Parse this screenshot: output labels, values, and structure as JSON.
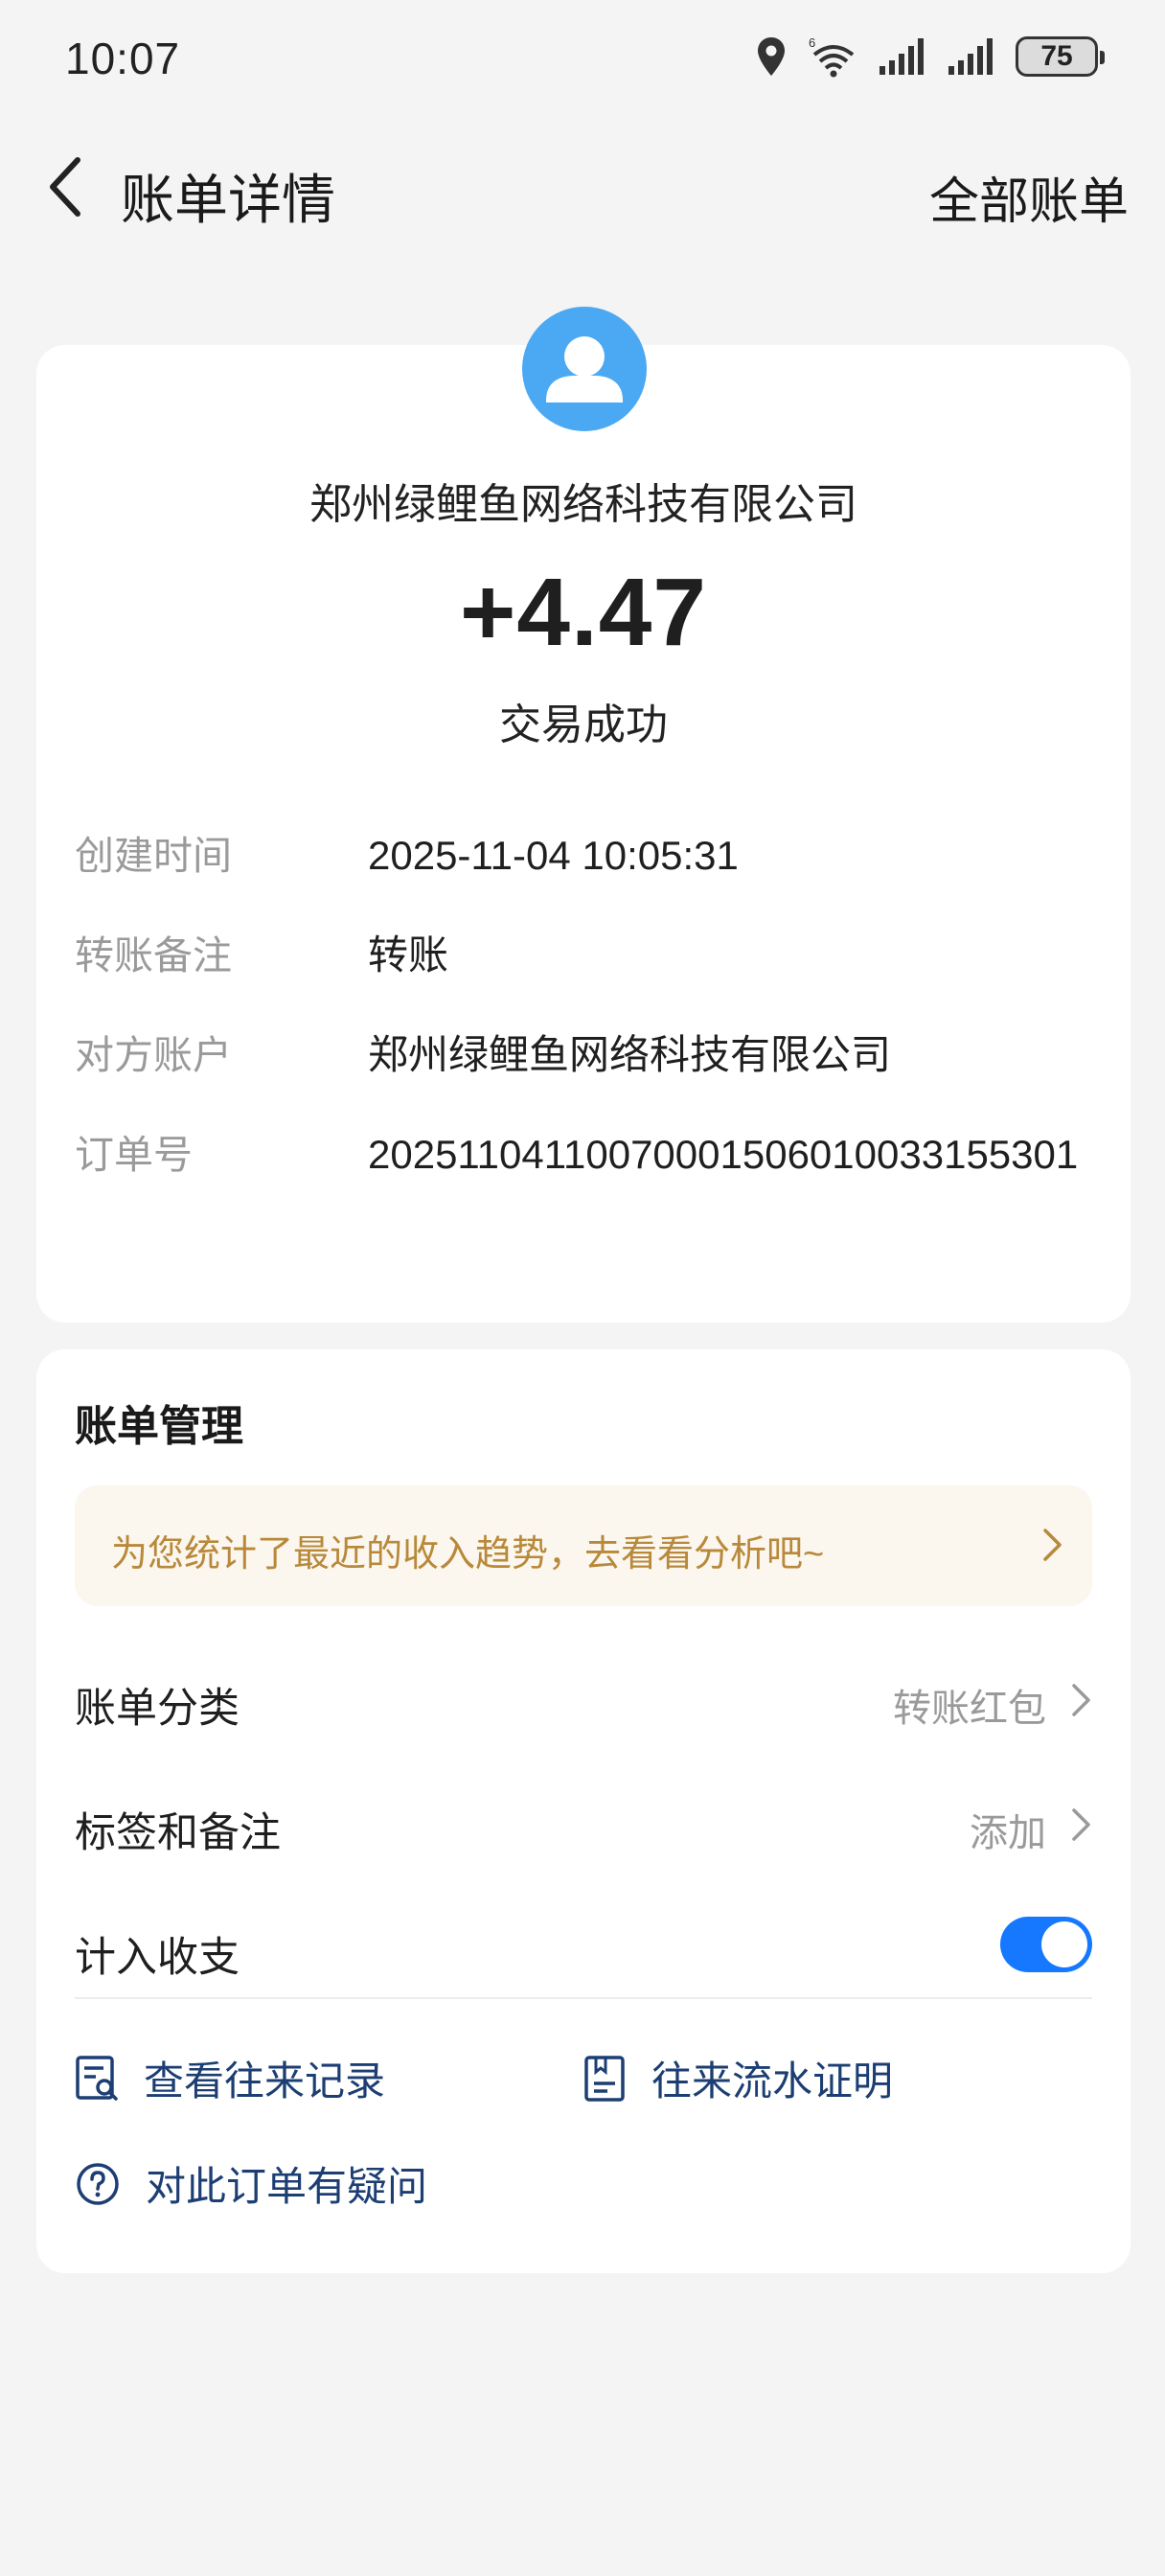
{
  "status_bar": {
    "time": "10:07",
    "battery": "75",
    "icons": [
      "location-icon",
      "wifi-icon",
      "signal-icon",
      "signal-icon",
      "battery-icon"
    ]
  },
  "nav": {
    "title": "账单详情",
    "right_link": "全部账单",
    "back_icon": "chevron-left-icon"
  },
  "summary": {
    "avatar_icon": "user-avatar-icon",
    "avatar_color": "#4ba8f3",
    "merchant": "郑州绿鲤鱼网络科技有限公司",
    "amount": "+4.47",
    "status": "交易成功",
    "details": [
      {
        "label": "创建时间",
        "value": "2025-11-04 10:05:31"
      },
      {
        "label": "转账备注",
        "value": "转账"
      },
      {
        "label": "对方账户",
        "value": "郑州绿鲤鱼网络科技有限公司"
      },
      {
        "label": "订单号",
        "value": "20251104110070001506010033155301"
      }
    ]
  },
  "management": {
    "title": "账单管理",
    "insight": "为您统计了最近的收入趋势，去看看分析吧~",
    "rows": [
      {
        "label": "账单分类",
        "value": "转账红包"
      },
      {
        "label": "标签和备注",
        "value": "添加"
      },
      {
        "label": "计入收支",
        "toggle": true
      }
    ],
    "links": [
      {
        "label": "查看往来记录",
        "icon": "record-search-icon"
      },
      {
        "label": "往来流水证明",
        "icon": "statement-icon"
      },
      {
        "label": "对此订单有疑问",
        "icon": "question-circle-icon"
      }
    ],
    "accent": "#1677ff",
    "link_color": "#1c3e73",
    "insight_color": "#b8893a"
  }
}
